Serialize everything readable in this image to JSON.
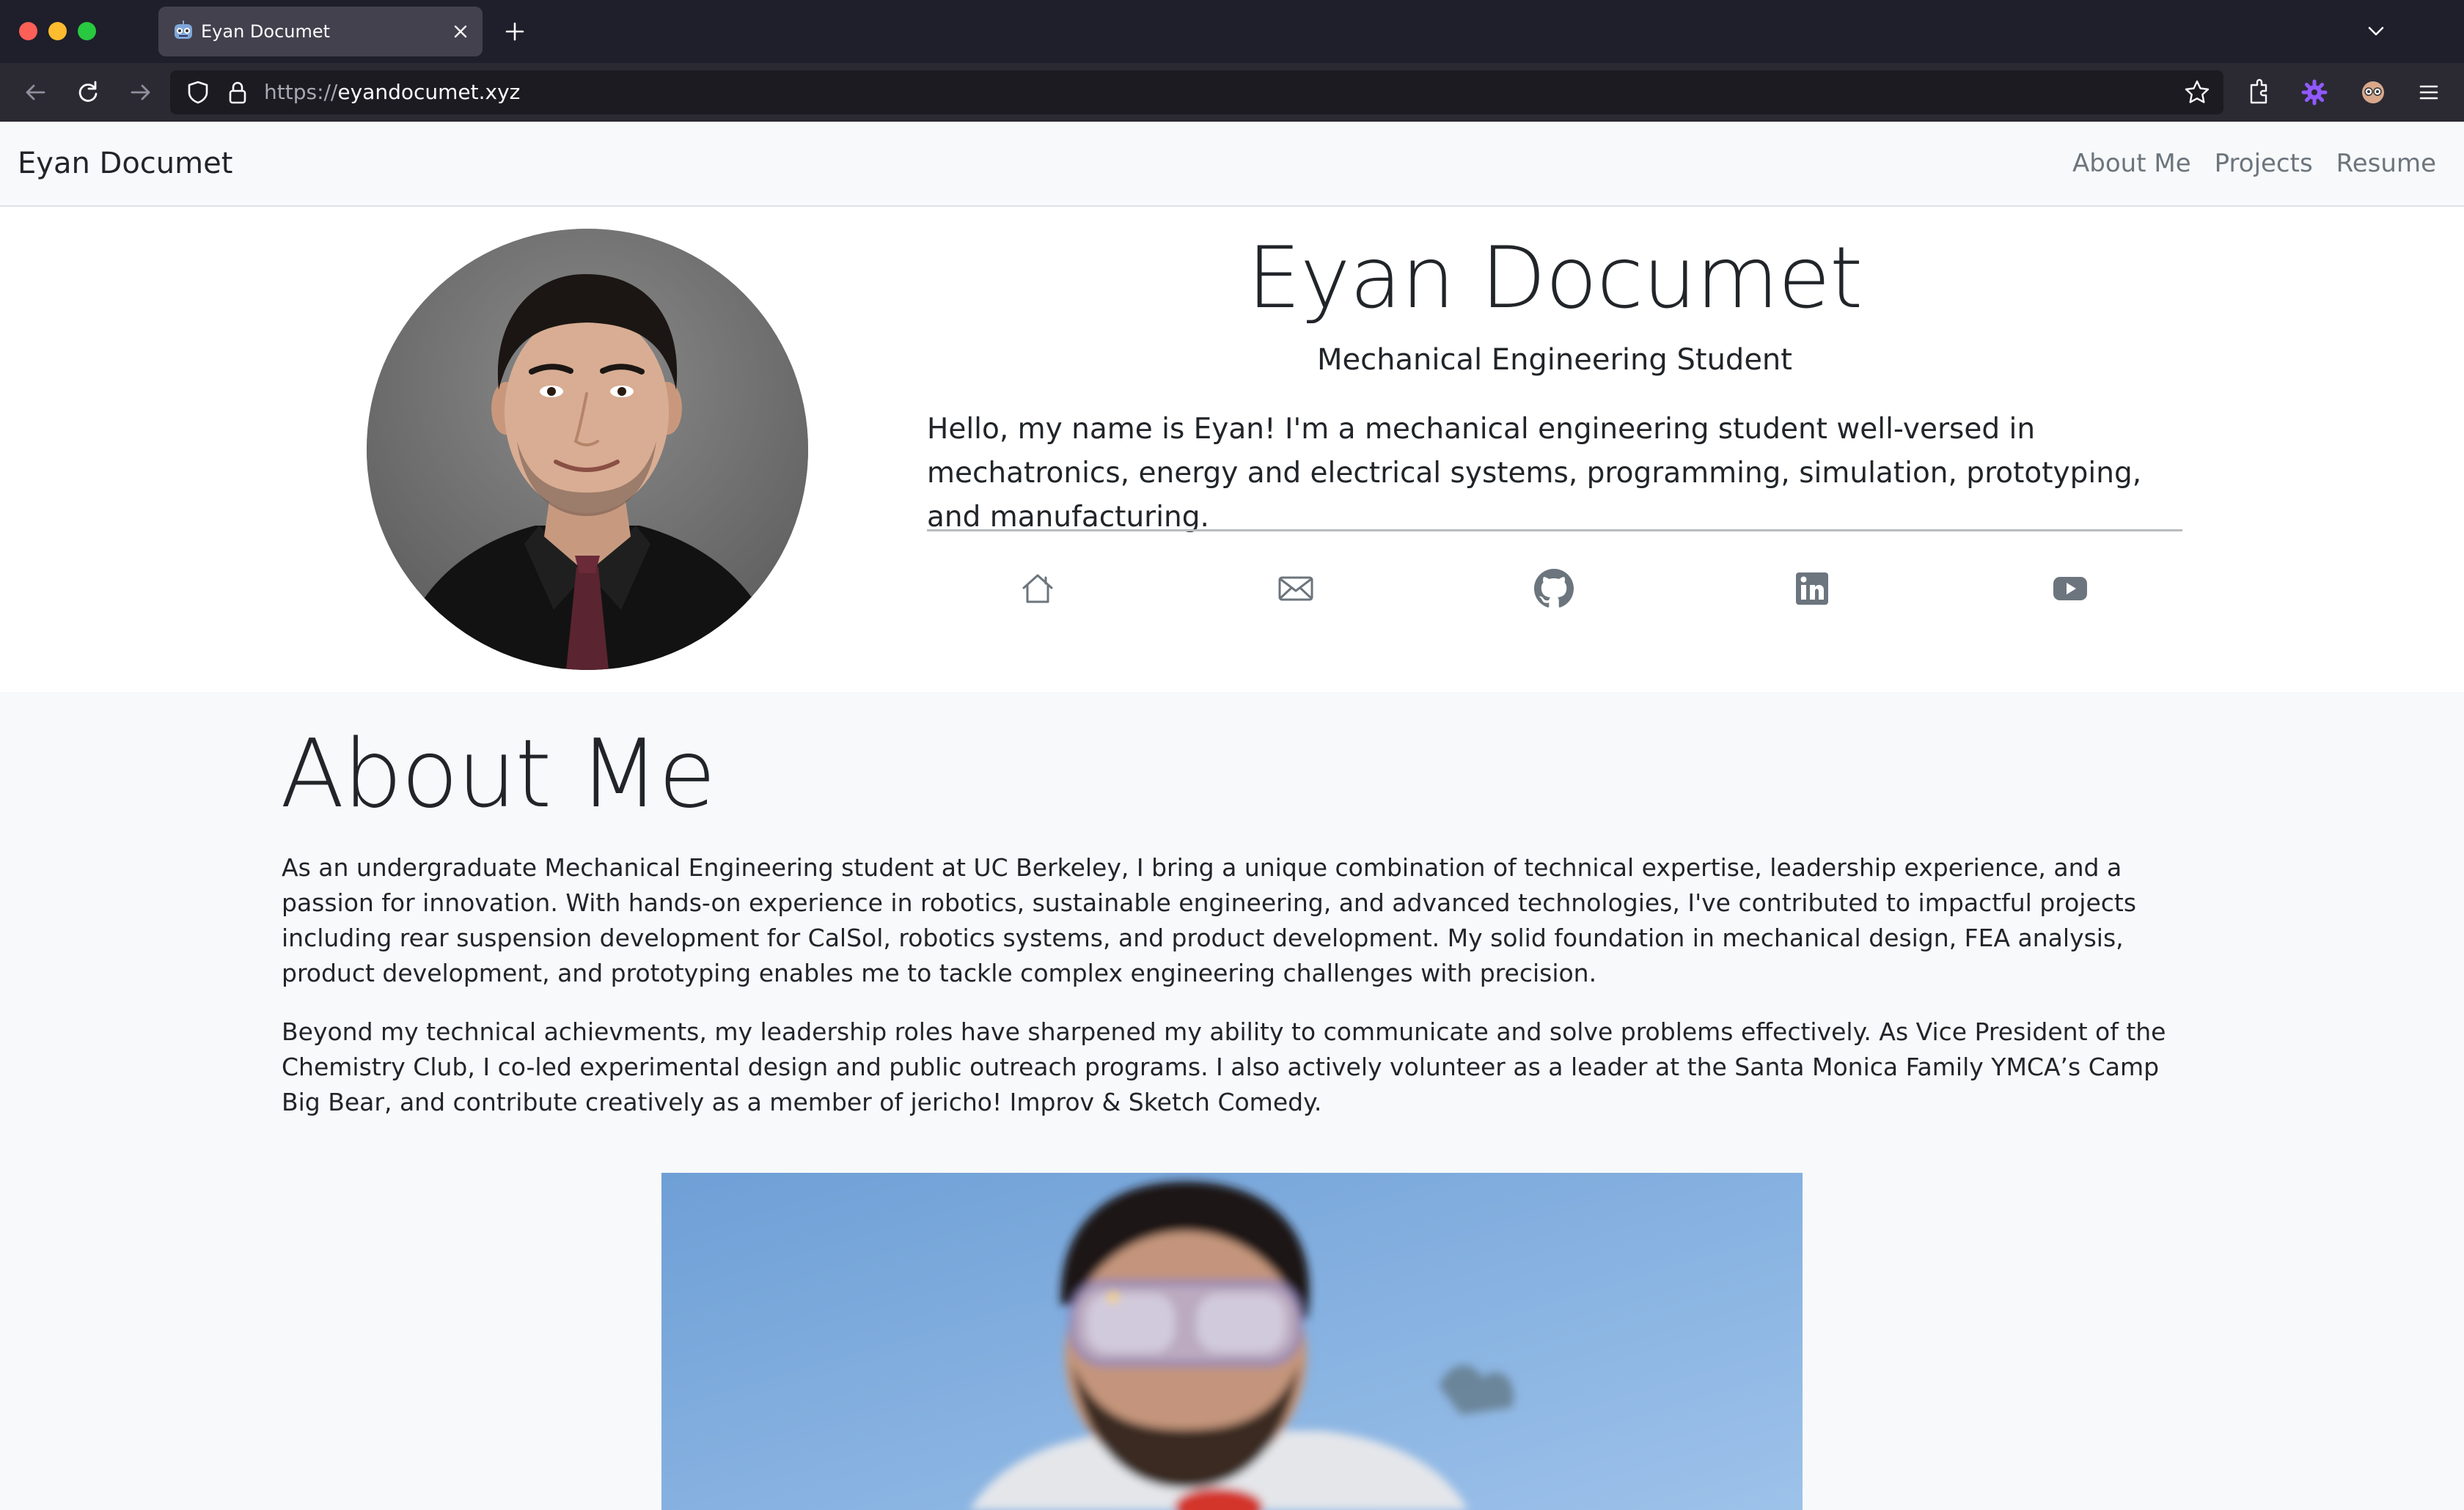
{
  "browser": {
    "tab_title": "Eyan Documet",
    "url_scheme": "https://",
    "url_host": "eyandocumet.xyz",
    "icons": [
      "back-icon",
      "reload-icon",
      "forward-icon",
      "shield-icon",
      "lock-icon",
      "star-icon",
      "extensions-icon",
      "gear-icon",
      "account-icon",
      "menu-icon"
    ]
  },
  "site_nav": {
    "brand": "Eyan Documet",
    "links": [
      "About Me",
      "Projects",
      "Resume"
    ]
  },
  "hero": {
    "name": "Eyan Documet",
    "subtitle": "Mechanical Engineering Student",
    "intro": "Hello, my name is Eyan! I'm a mechanical engineering student well-versed in mechatronics, energy and electrical systems, programming, simulation, prototyping, and manufacturing.",
    "social_icons": [
      "home-icon",
      "mail-icon",
      "github-icon",
      "linkedin-icon",
      "youtube-icon"
    ]
  },
  "about": {
    "title": "About Me",
    "paragraphs": [
      "As an undergraduate Mechanical Engineering student at UC Berkeley, I bring a unique combination of technical expertise, leadership experience, and a passion for innovation. With hands-on experience in robotics, sustainable engineering, and advanced technologies, I've contributed to impactful projects including rear suspension development for CalSol, robotics systems, and product development. My solid foundation in mechanical design, FEA analysis, product development, and prototyping enables me to tackle complex engineering challenges with precision.",
      "Beyond my technical achievments, my leadership roles have sharpened my ability to communicate and solve problems effectively. As Vice President of the Chemistry Club, I co-led experimental design and public outreach programs. I also actively volunteer as a leader at the Santa Monica Family YMCA’s Camp Big Bear, and contribute creatively as a member of jericho! Improv & Sketch Comedy."
    ]
  },
  "colors": {
    "chrome_dark": "#1f1e2b",
    "toolbar": "#2b2a33",
    "text": "#212529",
    "muted": "#6c757d",
    "page_bg": "#f8f9fa"
  }
}
